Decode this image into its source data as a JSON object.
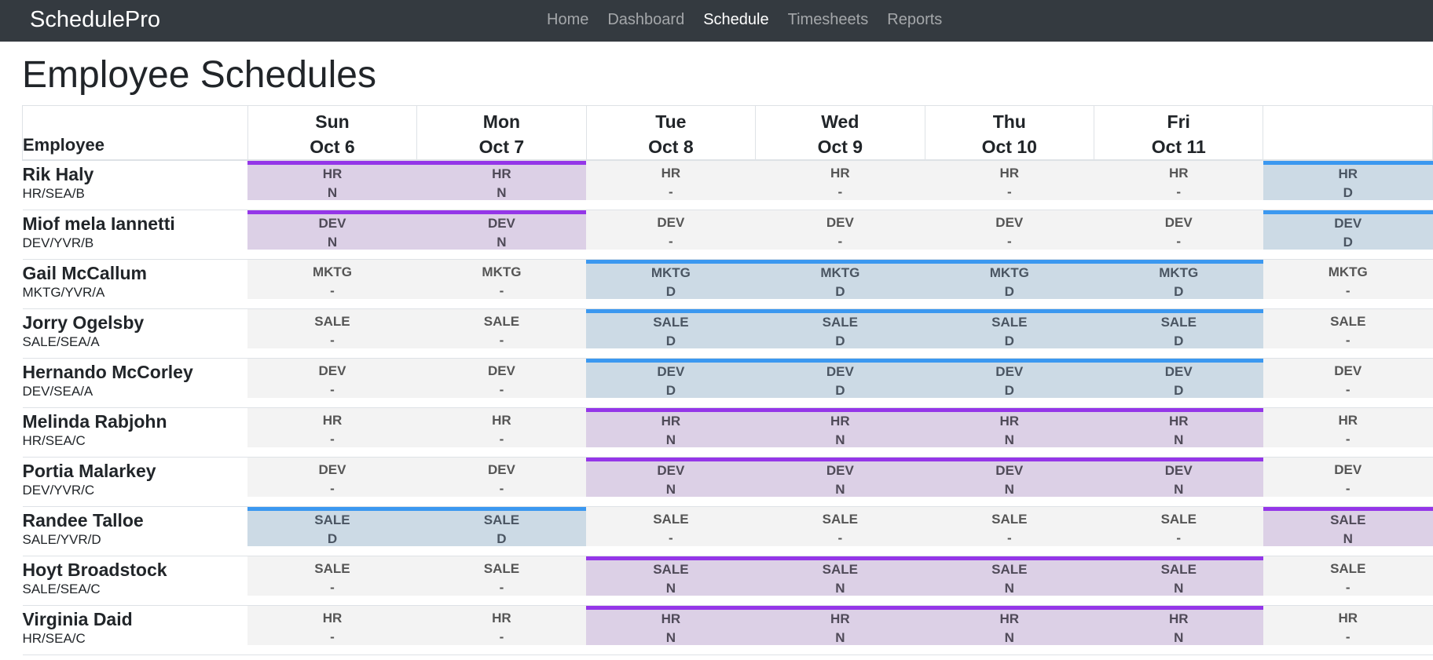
{
  "app": {
    "brand": "SchedulePro"
  },
  "nav": {
    "items": [
      {
        "label": "Home",
        "active": false
      },
      {
        "label": "Dashboard",
        "active": false
      },
      {
        "label": "Schedule",
        "active": true
      },
      {
        "label": "Timesheets",
        "active": false
      },
      {
        "label": "Reports",
        "active": false
      }
    ]
  },
  "page": {
    "title": "Employee Schedules"
  },
  "table": {
    "employee_header": "Employee",
    "days": [
      {
        "name": "Sun",
        "date": "Oct 6"
      },
      {
        "name": "Mon",
        "date": "Oct 7"
      },
      {
        "name": "Tue",
        "date": "Oct 8"
      },
      {
        "name": "Wed",
        "date": "Oct 9"
      },
      {
        "name": "Thu",
        "date": "Oct 10"
      },
      {
        "name": "Fri",
        "date": "Oct 11"
      },
      {
        "name": "",
        "date": ""
      }
    ],
    "shift_colors": {
      "day": "#3b98f0",
      "night": "#9436e8",
      "off": "#f3f3f3"
    },
    "rows": [
      {
        "name": "Rik Haly",
        "code": "HR/SEA/B",
        "dept": "HR",
        "shifts": [
          "N",
          "N",
          "-",
          "-",
          "-",
          "-",
          "D"
        ]
      },
      {
        "name": "Miof mela Iannetti",
        "code": "DEV/YVR/B",
        "dept": "DEV",
        "shifts": [
          "N",
          "N",
          "-",
          "-",
          "-",
          "-",
          "D"
        ]
      },
      {
        "name": "Gail McCallum",
        "code": "MKTG/YVR/A",
        "dept": "MKTG",
        "shifts": [
          "-",
          "-",
          "D",
          "D",
          "D",
          "D",
          "-"
        ]
      },
      {
        "name": "Jorry Ogelsby",
        "code": "SALE/SEA/A",
        "dept": "SALE",
        "shifts": [
          "-",
          "-",
          "D",
          "D",
          "D",
          "D",
          "-"
        ]
      },
      {
        "name": "Hernando McCorley",
        "code": "DEV/SEA/A",
        "dept": "DEV",
        "shifts": [
          "-",
          "-",
          "D",
          "D",
          "D",
          "D",
          "-"
        ]
      },
      {
        "name": "Melinda Rabjohn",
        "code": "HR/SEA/C",
        "dept": "HR",
        "shifts": [
          "-",
          "-",
          "N",
          "N",
          "N",
          "N",
          "-"
        ]
      },
      {
        "name": "Portia Malarkey",
        "code": "DEV/YVR/C",
        "dept": "DEV",
        "shifts": [
          "-",
          "-",
          "N",
          "N",
          "N",
          "N",
          "-"
        ]
      },
      {
        "name": "Randee Talloe",
        "code": "SALE/YVR/D",
        "dept": "SALE",
        "shifts": [
          "D",
          "D",
          "-",
          "-",
          "-",
          "-",
          "N"
        ]
      },
      {
        "name": "Hoyt Broadstock",
        "code": "SALE/SEA/C",
        "dept": "SALE",
        "shifts": [
          "-",
          "-",
          "N",
          "N",
          "N",
          "N",
          "-"
        ]
      },
      {
        "name": "Virginia Daid",
        "code": "HR/SEA/C",
        "dept": "HR",
        "shifts": [
          "-",
          "-",
          "N",
          "N",
          "N",
          "N",
          "-"
        ]
      }
    ]
  }
}
